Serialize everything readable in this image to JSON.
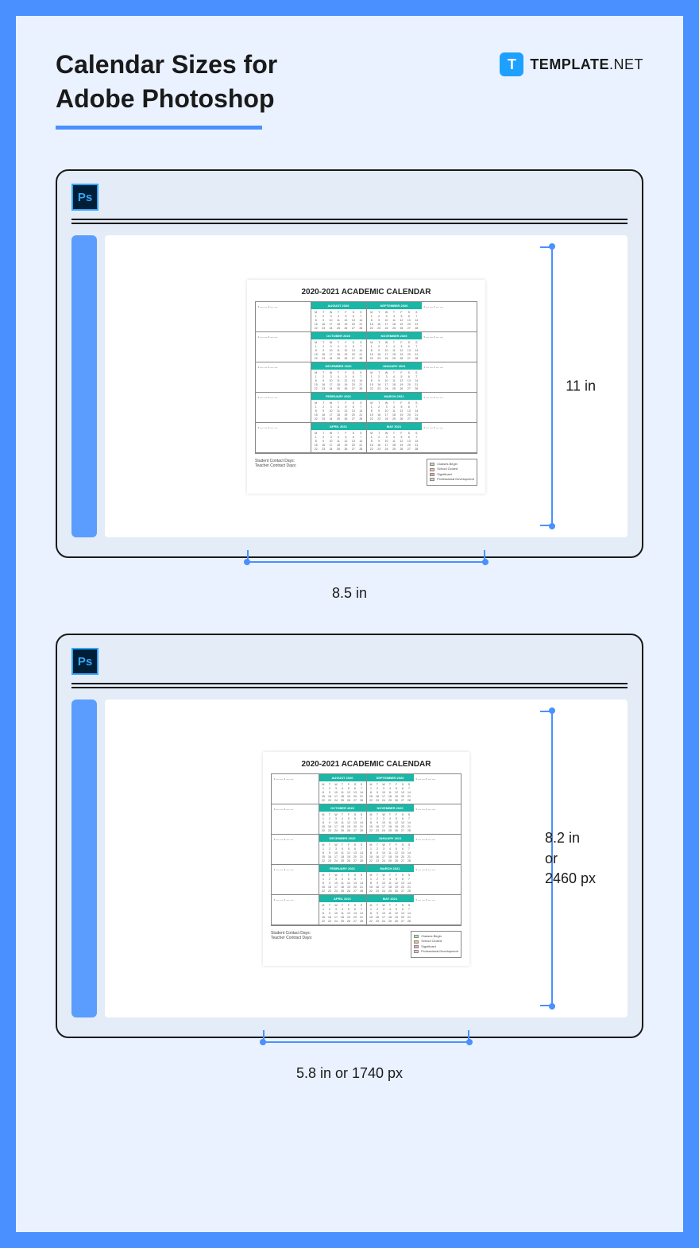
{
  "header": {
    "title": "Calendar Sizes for\nAdobe Photoshop",
    "brand_icon": "T",
    "brand_text_bold": "TEMPLATE",
    "brand_text_light": ".NET"
  },
  "ps_label": "Ps",
  "document": {
    "title": "2020-2021 ACADEMIC CALENDAR",
    "months": [
      "AUGUST 2020",
      "SEPTEMBER 2020",
      "OCTOBER 2020",
      "NOVEMBER 2020",
      "DECEMBER 2020",
      "JANUARY 2021",
      "FEBRUARY 2021",
      "MARCH 2021",
      "APRIL 2021",
      "MAY 2021"
    ],
    "footer_lines": [
      "Student Contact Days:",
      "Teacher Contract Days:"
    ],
    "legend": [
      "Classes Begin",
      "School Closed",
      "Significant",
      "Professional Development"
    ]
  },
  "card1": {
    "height_label": "11 in",
    "width_label": "8.5 in"
  },
  "card2": {
    "height_label": "8.2 in\nor\n2460 px",
    "width_label": "5.8 in or 1740 px"
  }
}
